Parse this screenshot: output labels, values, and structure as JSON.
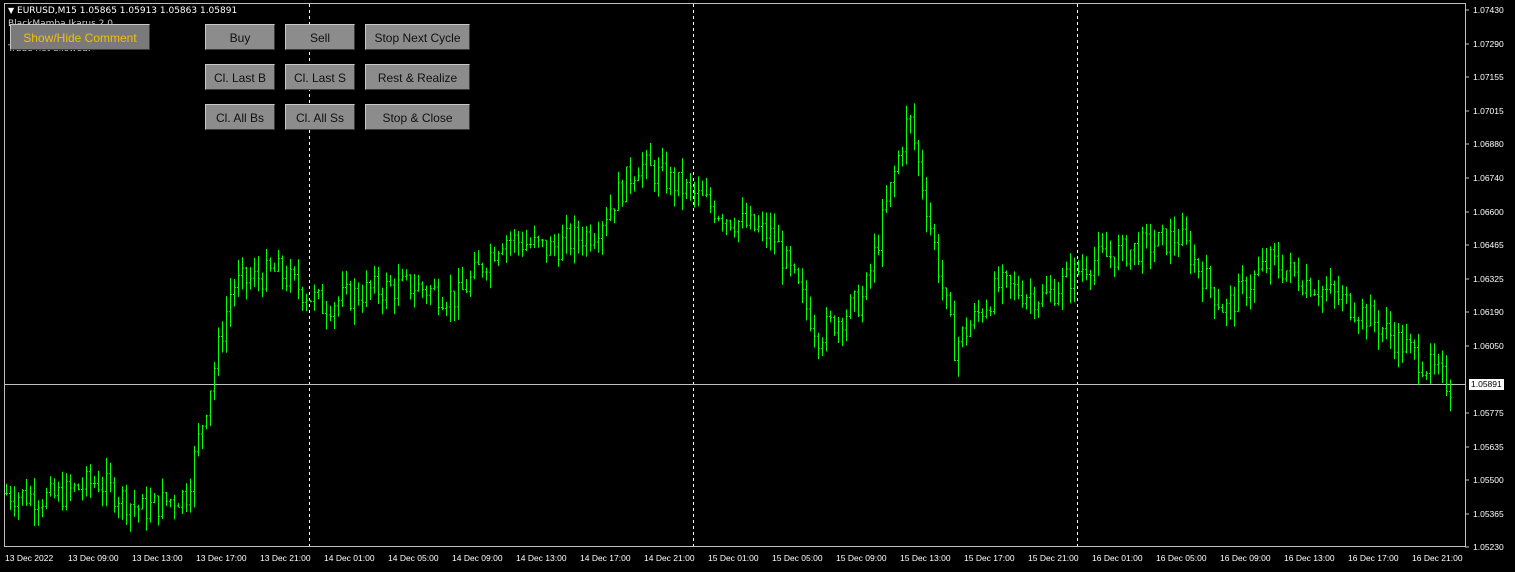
{
  "header": {
    "symbol_line": "EURUSD,M15  1.05865 1.05913 1.05863 1.05891",
    "ea_name": "BlackMamba Ikarus 2.0",
    "trade_status": "Trade not allowed."
  },
  "buttons": {
    "show_hide": "Show/Hide Comment",
    "buy": "Buy",
    "sell": "Sell",
    "stop_next_cycle": "Stop Next Cycle",
    "close_last_buy": "Cl. Last B",
    "close_last_sell": "Cl. Last S",
    "rest_realize": "Rest & Realize",
    "close_all_buys": "Cl. All Bs",
    "close_all_sells": "Cl. All Ss",
    "stop_close": "Stop & Close"
  },
  "price_axis": {
    "labels": [
      "1.07430",
      "1.07290",
      "1.07155",
      "1.07015",
      "1.06880",
      "1.06740",
      "1.06600",
      "1.06465",
      "1.06325",
      "1.06190",
      "1.06050",
      "1.05775",
      "1.05635",
      "1.05500",
      "1.05365",
      "1.05230"
    ],
    "current_price": "1.05891"
  },
  "time_axis": {
    "labels": [
      "13 Dec 2022",
      "13 Dec 09:00",
      "13 Dec 13:00",
      "13 Dec 17:00",
      "13 Dec 21:00",
      "14 Dec 01:00",
      "14 Dec 05:00",
      "14 Dec 09:00",
      "14 Dec 13:00",
      "14 Dec 17:00",
      "14 Dec 21:00",
      "15 Dec 01:00",
      "15 Dec 05:00",
      "15 Dec 09:00",
      "15 Dec 13:00",
      "15 Dec 17:00",
      "15 Dec 21:00",
      "16 Dec 01:00",
      "16 Dec 05:00",
      "16 Dec 09:00",
      "16 Dec 13:00",
      "16 Dec 17:00",
      "16 Dec 21:00"
    ]
  },
  "colors": {
    "background": "#000000",
    "bars": "#00ff00",
    "grid_separator": "#ffffff",
    "bid_line": "#c0c0c0",
    "comment_button_text": "#f0c000"
  },
  "chart_data": {
    "type": "ohlc",
    "symbol": "EURUSD",
    "timeframe": "M15",
    "ylim": [
      1.0523,
      1.0743
    ],
    "last_quote": {
      "open": 1.05865,
      "high": 1.05913,
      "low": 1.05863,
      "close": 1.05891
    },
    "x": [
      "13 Dec 2022",
      "13 Dec 09:00",
      "13 Dec 13:00",
      "13 Dec 17:00",
      "13 Dec 21:00",
      "14 Dec 01:00",
      "14 Dec 05:00",
      "14 Dec 09:00",
      "14 Dec 13:00",
      "14 Dec 17:00",
      "14 Dec 21:00",
      "15 Dec 01:00",
      "15 Dec 05:00",
      "15 Dec 09:00",
      "15 Dec 13:00",
      "15 Dec 17:00",
      "15 Dec 21:00",
      "16 Dec 01:00",
      "16 Dec 05:00",
      "16 Dec 09:00",
      "16 Dec 13:00",
      "16 Dec 17:00",
      "16 Dec 21:00"
    ],
    "close_path": [
      1.0545,
      1.0543,
      1.055,
      1.0538,
      1.0545,
      1.063,
      1.0636,
      1.0622,
      1.0628,
      1.063,
      1.0625,
      1.065,
      1.0645,
      1.0652,
      1.068,
      1.067,
      1.0658,
      1.065,
      1.061,
      1.0625,
      1.07,
      1.0605,
      1.063,
      1.0625,
      1.064,
      1.0645,
      1.065,
      1.062,
      1.064,
      1.063,
      1.062,
      1.0605,
      1.0589
    ]
  }
}
